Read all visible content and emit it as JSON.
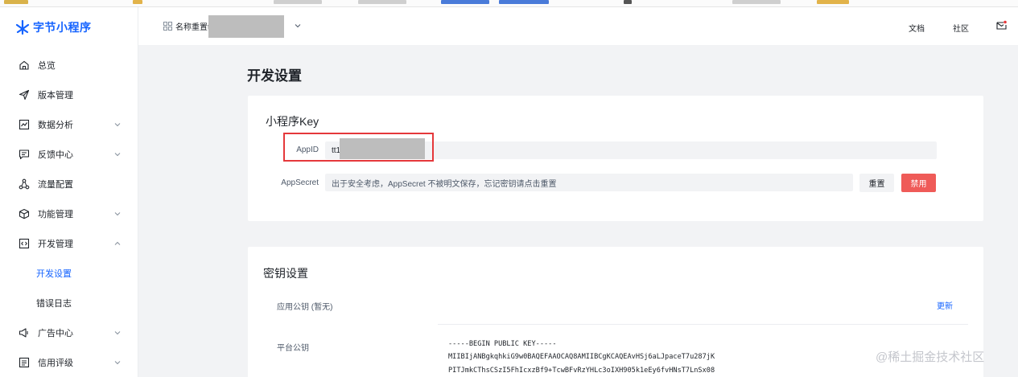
{
  "brand": {
    "name": "字节小程序",
    "color": "#1664ff"
  },
  "header": {
    "app_name": "名称重置t",
    "links": [
      "文档",
      "社区"
    ],
    "icons": [
      "grid-icon",
      "chevron-down-icon",
      "mail-icon"
    ]
  },
  "sidebar": {
    "items": [
      {
        "label": "总览",
        "icon": "home-icon"
      },
      {
        "label": "版本管理",
        "icon": "send-icon"
      },
      {
        "label": "数据分析",
        "icon": "chart-icon",
        "expandable": true
      },
      {
        "label": "反馈中心",
        "icon": "message-icon",
        "expandable": true
      },
      {
        "label": "流量配置",
        "icon": "share-icon"
      },
      {
        "label": "功能管理",
        "icon": "cube-icon",
        "expandable": true
      },
      {
        "label": "开发管理",
        "icon": "code-icon",
        "expandable": true,
        "expanded": true
      },
      {
        "label": "开发设置",
        "sub": true,
        "active": true
      },
      {
        "label": "错误日志",
        "sub": true
      },
      {
        "label": "广告中心",
        "icon": "speaker-icon",
        "expandable": true
      },
      {
        "label": "信用评级",
        "icon": "list-icon",
        "expandable": true
      }
    ]
  },
  "main": {
    "title": "开发设置",
    "key_section": {
      "title": "小程序Key",
      "appid_label": "AppID",
      "appid_value": "tt1",
      "appsecret_label": "AppSecret",
      "appsecret_value": "出于安全考虑，AppSecret 不被明文保存，忘记密钥请点击重置",
      "reset_label": "重置",
      "disable_label": "禁用"
    },
    "secret_section": {
      "title": "密钥设置",
      "app_pubkey_label": "应用公钥 (暂无)",
      "update_label": "更新",
      "platform_pubkey_label": "平台公钥",
      "platform_pubkey_lines": [
        "-----BEGIN PUBLIC KEY-----",
        "MIIBIjANBgkqhkiG9w0BAQEFAAOCAQ8AMIIBCgKCAQEAvHSj6aLJpaceT7u287jK",
        "PITJmkCThsCSzI5FhIcxzBf9+TcwBFvRzYHLc3oIXH905k1eEy6fvHNsT7LnSx08"
      ]
    }
  },
  "colors": {
    "accent": "#1664ff",
    "danger": "#ef5b58",
    "highlight_box": "#e5383b"
  },
  "watermark": "@稀土掘金技术社区"
}
